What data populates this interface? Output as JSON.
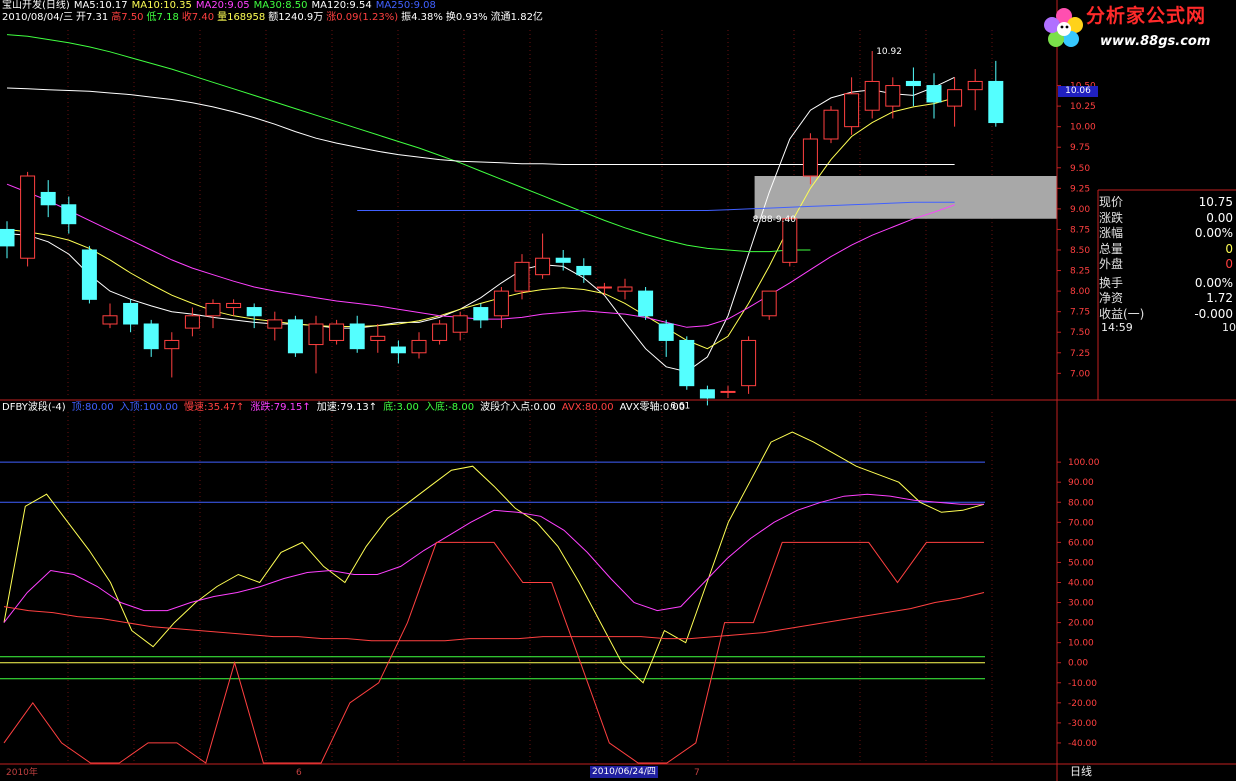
{
  "header": {
    "items": [
      {
        "text": "宝山开发(日线)",
        "color": "#ffffff"
      },
      {
        "text": "MA5:10.17",
        "color": "#ffffff"
      },
      {
        "text": "MA10:10.35",
        "color": "#ffff54"
      },
      {
        "text": "MA20:9.05",
        "color": "#ff40ff"
      },
      {
        "text": "MA30:8.50",
        "color": "#40ff40"
      },
      {
        "text": "MA120:9.54",
        "color": "#ffffff"
      },
      {
        "text": "MA250:9.08",
        "color": "#4060ff"
      }
    ],
    "date_row": [
      {
        "text": "2010/08/04/三",
        "color": "#ffffff"
      },
      {
        "text": "开7.31",
        "color": "#ffffff"
      },
      {
        "text": "高7.50",
        "color": "#ff4040"
      },
      {
        "text": "低7.18",
        "color": "#40ff40"
      },
      {
        "text": "收7.40",
        "color": "#ff4040"
      },
      {
        "text": "量168958",
        "color": "#ffff54"
      },
      {
        "text": "额1240.9万",
        "color": "#ffffff"
      },
      {
        "text": "涨0.09(1.23%)",
        "color": "#ff4040"
      },
      {
        "text": "振4.38%",
        "color": "#ffffff"
      },
      {
        "text": "换0.93%",
        "color": "#ffffff"
      },
      {
        "text": "流通1.82亿",
        "color": "#ffffff"
      }
    ]
  },
  "logo": {
    "brand": "分析家公式网",
    "url": "www.88gs.com"
  },
  "price_tag": "10.06",
  "indicator": {
    "items": [
      {
        "text": "DFBY波段(-4)",
        "color": "#ffffff"
      },
      {
        "text": "顶:80.00",
        "color": "#4060ff"
      },
      {
        "text": "入顶:100.00",
        "color": "#4060ff"
      },
      {
        "text": "慢速:35.47↑",
        "color": "#ff4040"
      },
      {
        "text": "涨跌:79.15↑",
        "color": "#ff40ff"
      },
      {
        "text": "加速:79.13↑",
        "color": "#ffffff"
      },
      {
        "text": "底:3.00",
        "color": "#40ff40"
      },
      {
        "text": "入底:-8.00",
        "color": "#40ff40"
      },
      {
        "text": "波段介入点:0.00",
        "color": "#ffffff"
      },
      {
        "text": "AVX:80.00",
        "color": "#ff4040"
      },
      {
        "text": "AVX零轴:0.00",
        "color": "#ffffff"
      }
    ]
  },
  "quote": {
    "rows": [
      {
        "label": "现价",
        "value": "10.75",
        "color": "white"
      },
      {
        "label": "涨跌",
        "value": "0.00",
        "color": "white"
      },
      {
        "label": "涨幅",
        "value": "0.00%",
        "color": "white"
      },
      {
        "label": "总量",
        "value": "0",
        "color": "yel"
      },
      {
        "label": "外盘",
        "value": "0",
        "color": "red"
      },
      {
        "label": "换手",
        "value": "0.00%",
        "color": "white"
      },
      {
        "label": "净资",
        "value": "1.72",
        "color": "white"
      },
      {
        "label": "收益(一)",
        "value": "-0.000",
        "color": "white"
      }
    ],
    "time": "14:59",
    "time_value": "10"
  },
  "bottom": {
    "mode": "日线",
    "date_badge": "2010/06/24/四",
    "x_start": "2010年",
    "x_6": "6",
    "x_7": "7"
  },
  "chart_data": [
    {
      "type": "candlestick",
      "title": "",
      "ylim": [
        6.7,
        11.2
      ],
      "y_ticks": [
        "7.00",
        "7.25",
        "7.50",
        "7.75",
        "8.00",
        "8.25",
        "8.50",
        "8.75",
        "9.00",
        "9.25",
        "9.50",
        "9.75",
        "10.00",
        "10.25",
        "10.50"
      ],
      "annotations": [
        {
          "text": "10.92",
          "at": [
            42,
            10.92
          ]
        },
        {
          "text": "6.61",
          "at": [
            32,
            6.61
          ]
        },
        {
          "text": "8.88-9.40",
          "at": [
            36,
            8.88
          ]
        }
      ],
      "highlight_band": {
        "ymin": 8.88,
        "ymax": 9.4
      },
      "mas": {
        "MA5": {
          "color": "#ffffff",
          "values": [
            8.7,
            8.68,
            8.6,
            8.45,
            8.2,
            8.0,
            7.9,
            7.82,
            7.75,
            7.72,
            7.68,
            7.65,
            7.62,
            7.6,
            7.6,
            7.58,
            7.55,
            7.55,
            7.58,
            7.62,
            7.62,
            7.68,
            7.78,
            7.92,
            8.1,
            8.26,
            8.32,
            8.3,
            8.16,
            7.95,
            7.62,
            7.3,
            7.08,
            7.02,
            7.2,
            7.7,
            8.45,
            9.2,
            9.85,
            10.2,
            10.35,
            10.42,
            10.45,
            10.4,
            10.38,
            10.48,
            10.6
          ]
        },
        "MA10": {
          "color": "#ffff54",
          "values": [
            8.75,
            8.72,
            8.68,
            8.62,
            8.52,
            8.38,
            8.22,
            8.08,
            7.95,
            7.85,
            7.76,
            7.7,
            7.66,
            7.63,
            7.6,
            7.58,
            7.57,
            7.57,
            7.58,
            7.6,
            7.64,
            7.7,
            7.78,
            7.85,
            7.92,
            7.98,
            8.02,
            8.04,
            8.02,
            7.97,
            7.85,
            7.7,
            7.55,
            7.4,
            7.3,
            7.45,
            7.85,
            8.3,
            8.8,
            9.25,
            9.6,
            9.88,
            10.05,
            10.18,
            10.24,
            10.28,
            10.35
          ]
        },
        "MA20": {
          "color": "#ff40ff",
          "values": [
            9.3,
            9.2,
            9.1,
            8.98,
            8.86,
            8.74,
            8.62,
            8.5,
            8.38,
            8.28,
            8.2,
            8.12,
            8.05,
            8.0,
            7.96,
            7.92,
            7.88,
            7.85,
            7.82,
            7.78,
            7.74,
            7.7,
            7.68,
            7.66,
            7.66,
            7.68,
            7.72,
            7.74,
            7.76,
            7.74,
            7.72,
            7.68,
            7.62,
            7.56,
            7.58,
            7.66,
            7.8,
            7.95,
            8.1,
            8.26,
            8.42,
            8.56,
            8.68,
            8.78,
            8.88,
            8.96,
            9.05
          ]
        },
        "MA30": {
          "color": "#40ff40",
          "values": [
            11.12,
            11.1,
            11.06,
            11.02,
            10.97,
            10.91,
            10.84,
            10.77,
            10.7,
            10.62,
            10.54,
            10.46,
            10.38,
            10.3,
            10.22,
            10.14,
            10.06,
            9.98,
            9.9,
            9.82,
            9.74,
            9.65,
            9.56,
            9.46,
            9.36,
            9.26,
            9.16,
            9.06,
            8.96,
            8.86,
            8.77,
            8.69,
            8.62,
            8.56,
            8.52,
            8.5,
            8.48,
            8.48,
            8.5,
            8.5
          ]
        },
        "MA120": {
          "color": "#ffffff",
          "values": [
            10.47,
            10.46,
            10.45,
            10.44,
            10.43,
            10.41,
            10.39,
            10.36,
            10.33,
            10.29,
            10.24,
            10.18,
            10.11,
            10.03,
            9.94,
            9.86,
            9.8,
            9.75,
            9.7,
            9.66,
            9.63,
            9.6,
            9.58,
            9.57,
            9.56,
            9.55,
            9.55,
            9.54,
            9.54,
            9.54,
            9.54,
            9.54,
            9.54,
            9.54,
            9.54,
            9.54,
            9.54,
            9.54,
            9.54,
            9.54,
            9.54,
            9.54,
            9.54,
            9.54,
            9.54,
            9.54,
            9.54
          ]
        },
        "MA250": {
          "color": "#4060ff",
          "start": 17,
          "values": [
            8.98,
            8.98,
            8.98,
            8.98,
            8.98,
            8.98,
            8.98,
            8.98,
            8.98,
            8.98,
            8.98,
            8.98,
            8.98,
            8.98,
            8.98,
            8.98,
            8.98,
            8.98,
            8.99,
            9.0,
            9.01,
            9.02,
            9.03,
            9.04,
            9.05,
            9.06,
            9.07,
            9.08,
            9.08,
            9.08
          ]
        }
      },
      "candles": [
        [
          8.75,
          8.55,
          8.85,
          8.4
        ],
        [
          8.4,
          9.4,
          9.45,
          8.3
        ],
        [
          9.2,
          9.05,
          9.35,
          8.9
        ],
        [
          9.05,
          8.82,
          9.15,
          8.7
        ],
        [
          8.5,
          7.9,
          8.55,
          7.85
        ],
        [
          7.6,
          7.7,
          7.85,
          7.55
        ],
        [
          7.85,
          7.6,
          7.9,
          7.5
        ],
        [
          7.6,
          7.3,
          7.65,
          7.2
        ],
        [
          7.3,
          7.4,
          7.5,
          6.95
        ],
        [
          7.55,
          7.7,
          7.8,
          7.45
        ],
        [
          7.7,
          7.85,
          7.9,
          7.55
        ],
        [
          7.8,
          7.85,
          7.9,
          7.7
        ],
        [
          7.8,
          7.7,
          7.85,
          7.55
        ],
        [
          7.55,
          7.65,
          7.75,
          7.4
        ],
        [
          7.65,
          7.25,
          7.7,
          7.2
        ],
        [
          7.35,
          7.6,
          7.7,
          7.0
        ],
        [
          7.4,
          7.6,
          7.65,
          7.35
        ],
        [
          7.6,
          7.3,
          7.7,
          7.25
        ],
        [
          7.4,
          7.45,
          7.6,
          7.25
        ],
        [
          7.32,
          7.25,
          7.4,
          7.12
        ],
        [
          7.25,
          7.4,
          7.5,
          7.18
        ],
        [
          7.4,
          7.6,
          7.65,
          7.35
        ],
        [
          7.5,
          7.7,
          7.75,
          7.4
        ],
        [
          7.8,
          7.65,
          7.85,
          7.55
        ],
        [
          7.7,
          8.0,
          8.05,
          7.55
        ],
        [
          8.0,
          8.35,
          8.45,
          7.9
        ],
        [
          8.2,
          8.4,
          8.7,
          8.15
        ],
        [
          8.4,
          8.35,
          8.5,
          8.25
        ],
        [
          8.3,
          8.2,
          8.4,
          8.1
        ],
        [
          8.05,
          8.05,
          8.1,
          7.95
        ],
        [
          8.0,
          8.05,
          8.15,
          7.9
        ],
        [
          8.0,
          7.7,
          8.05,
          7.65
        ],
        [
          7.6,
          7.4,
          7.65,
          7.2
        ],
        [
          7.4,
          6.85,
          7.45,
          6.8
        ],
        [
          6.8,
          6.7,
          6.85,
          6.61
        ],
        [
          6.78,
          6.78,
          6.85,
          6.7
        ],
        [
          6.85,
          7.4,
          7.45,
          6.75
        ],
        [
          7.7,
          8.0,
          8.0,
          7.65
        ],
        [
          8.35,
          8.88,
          8.9,
          8.3
        ],
        [
          9.4,
          9.85,
          9.92,
          9.3
        ],
        [
          9.85,
          10.2,
          10.25,
          9.8
        ],
        [
          10.0,
          10.4,
          10.6,
          9.9
        ],
        [
          10.2,
          10.55,
          10.92,
          10.1
        ],
        [
          10.25,
          10.5,
          10.6,
          10.1
        ],
        [
          10.55,
          10.5,
          10.72,
          10.25
        ],
        [
          10.5,
          10.3,
          10.65,
          10.1
        ],
        [
          10.25,
          10.45,
          10.6,
          10.0
        ],
        [
          10.45,
          10.55,
          10.7,
          10.2
        ],
        [
          10.55,
          10.05,
          10.8,
          10.0
        ]
      ]
    },
    {
      "type": "line",
      "title": "",
      "ylim": [
        -50,
        125
      ],
      "y_ticks": [
        "100.00",
        "90.00",
        "80.00",
        "70.00",
        "60.00",
        "50.00",
        "40.00",
        "30.00",
        "20.00",
        "10.00",
        "0.00",
        "-10.00",
        "-20.00",
        "-30.00",
        "-40.00"
      ],
      "hlines": [
        {
          "name": "入顶",
          "value": 100,
          "color": "#4060ff"
        },
        {
          "name": "顶",
          "value": 80,
          "color": "#4060ff"
        },
        {
          "name": "底",
          "value": 3,
          "color": "#40ff40"
        },
        {
          "name": "AVX零轴",
          "value": 0,
          "color": "#ffff54"
        },
        {
          "name": "入底",
          "value": -8,
          "color": "#40ff40"
        }
      ],
      "series": [
        {
          "name": "加速",
          "color": "#ffff54",
          "values": [
            20,
            78,
            84,
            70,
            56,
            40,
            16,
            8,
            20,
            30,
            38,
            44,
            40,
            55,
            60,
            48,
            40,
            58,
            72,
            80,
            88,
            96,
            98,
            88,
            77,
            70,
            58,
            40,
            20,
            0,
            -10,
            16,
            10,
            40,
            70,
            90,
            110,
            115,
            110,
            104,
            98,
            94,
            90,
            80,
            75,
            76,
            79
          ]
        },
        {
          "name": "涨跌",
          "color": "#ff40ff",
          "values": [
            20,
            35,
            46,
            44,
            38,
            30,
            26,
            26,
            30,
            33,
            35,
            38,
            42,
            45,
            46,
            44,
            44,
            48,
            56,
            63,
            70,
            76,
            75,
            73,
            66,
            55,
            42,
            30,
            26,
            28,
            40,
            52,
            62,
            70,
            76,
            80,
            83,
            84,
            83,
            81,
            80,
            79,
            79
          ]
        },
        {
          "name": "慢速",
          "color": "#ff4040",
          "values": [
            28,
            26,
            25,
            23,
            22,
            20,
            18,
            17,
            16,
            15,
            14,
            13,
            13,
            12,
            12,
            11,
            11,
            11,
            11,
            12,
            12,
            12,
            13,
            13,
            13,
            13,
            13,
            12,
            12,
            13,
            14,
            15,
            17,
            19,
            21,
            23,
            25,
            27,
            30,
            32,
            35
          ]
        },
        {
          "name": "AVX",
          "color": "#ff4040",
          "values": [
            -40,
            -20,
            -40,
            -50,
            -50,
            -40,
            -40,
            -50,
            0,
            -50,
            -50,
            -50,
            -20,
            -10,
            20,
            60,
            60,
            60,
            40,
            40,
            0,
            -40,
            -50,
            -50,
            -40,
            20,
            20,
            60,
            60,
            60,
            60,
            40,
            60,
            60,
            60
          ]
        }
      ]
    }
  ]
}
